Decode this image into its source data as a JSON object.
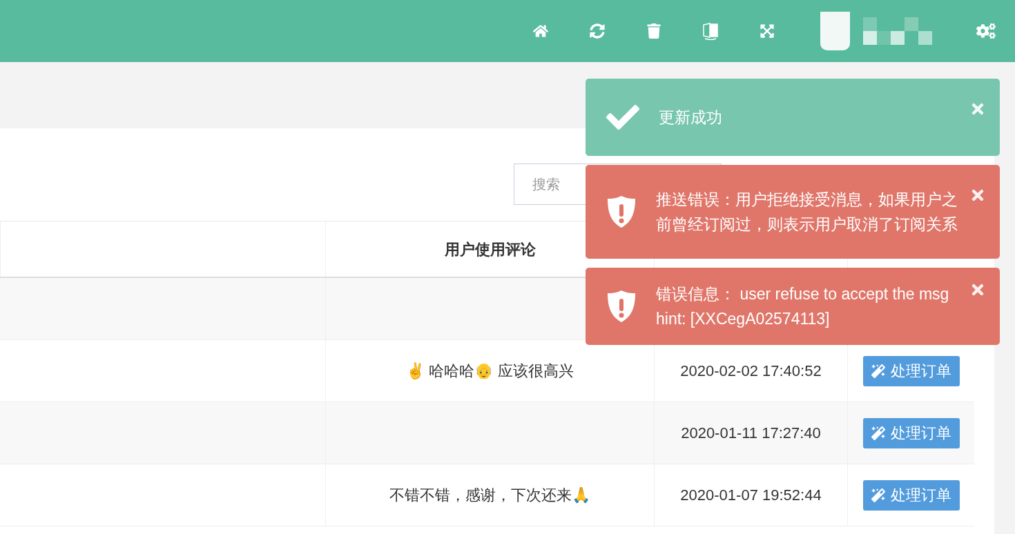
{
  "header": {
    "user_name_pixelated": true
  },
  "search": {
    "placeholder": "搜索"
  },
  "table": {
    "comment_header": "用户使用评论",
    "rows": [
      {
        "comment": ""
      },
      {
        "comment": "✌️ 哈哈哈👴 应该很高兴",
        "time": "2020-02-02 17:40:52",
        "action": "处理订单"
      },
      {
        "comment": "",
        "time": "2020-01-11 17:27:40",
        "action": "处理订单"
      },
      {
        "comment": "不错不错，感谢，下次还来🙏",
        "time": "2020-01-07 19:52:44",
        "action": "处理订单"
      }
    ]
  },
  "toasts": [
    {
      "kind": "success",
      "message": "更新成功"
    },
    {
      "kind": "error",
      "message": "推送错误：用户拒绝接受消息，如果用户之前曾经订阅过，则表示用户取消了订阅关系"
    },
    {
      "kind": "error",
      "message": "错误信息： user refuse to accept the msg hint: [XXCegA02574113]"
    }
  ]
}
